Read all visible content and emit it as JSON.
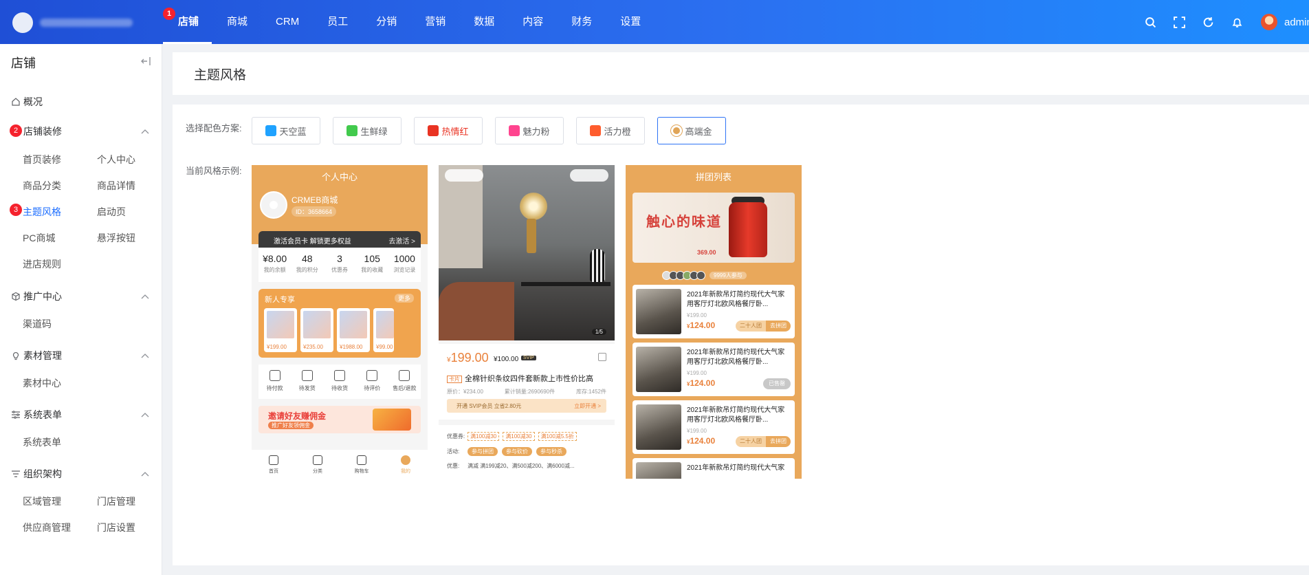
{
  "header": {
    "nav": [
      "店铺",
      "商城",
      "CRM",
      "员工",
      "分销",
      "营销",
      "数据",
      "内容",
      "财务",
      "设置"
    ],
    "active_index": 0,
    "nav_badge": "1",
    "user": "admin"
  },
  "sidebar": {
    "title": "店铺",
    "groups": [
      {
        "label": "概况"
      },
      {
        "label": "店铺装修",
        "badge": "2",
        "items": [
          "首页装修",
          "个人中心",
          "商品分类",
          "商品详情",
          "主题风格",
          "启动页",
          "PC商城",
          "悬浮按钮",
          "进店规则"
        ]
      },
      {
        "label": "推广中心",
        "items": [
          "渠道码"
        ]
      },
      {
        "label": "素材管理",
        "items": [
          "素材中心"
        ]
      },
      {
        "label": "系统表单",
        "items": [
          "系统表单"
        ]
      },
      {
        "label": "组织架构",
        "items": [
          "区域管理",
          "门店管理",
          "供应商管理",
          "门店设置"
        ]
      }
    ],
    "active_item": "主题风格",
    "active_badge": "3"
  },
  "page": {
    "title": "主题风格",
    "scheme_label": "选择配色方案:",
    "example_label": "当前风格示例:",
    "schemes": [
      {
        "name": "天空蓝",
        "color": "#1fa2ff"
      },
      {
        "name": "生鲜绿",
        "color": "#42ca4d"
      },
      {
        "name": "热情红",
        "color": "#e93323"
      },
      {
        "name": "魅力粉",
        "color": "#ff448f"
      },
      {
        "name": "活力橙",
        "color": "#fe5c2d"
      },
      {
        "name": "高端金",
        "color": "#e0a558"
      }
    ],
    "selected_scheme": "高端金",
    "hot_scheme_text_color": "#e93323"
  },
  "phone1": {
    "title": "个人中心",
    "user_name": "CRMEB商城",
    "user_id": "ID：3658664",
    "vip_text": "激活会员卡 解锁更多权益",
    "vip_action": "去激活 >",
    "stats": [
      {
        "value": "¥8.00",
        "label": "我的余额"
      },
      {
        "value": "48",
        "label": "我的积分"
      },
      {
        "value": "3",
        "label": "优惠券"
      },
      {
        "value": "105",
        "label": "我的收藏"
      },
      {
        "value": "1000",
        "label": "浏览记录"
      }
    ],
    "new_title": "新人专享",
    "new_more": "更多",
    "new_prices": [
      "¥199.00",
      "¥235.00",
      "¥1988.00",
      "¥99.00"
    ],
    "orders": [
      "待付款",
      "待发货",
      "待收货",
      "待评价",
      "售后/退款"
    ],
    "invite_title": "邀请好友赚佣金",
    "invite_sub": "推广好友领佣金",
    "tabs": [
      "首页",
      "分类",
      "购物车",
      "我的"
    ]
  },
  "phone2": {
    "pager": "1/5",
    "price": "199.00",
    "old_price": "¥100.00",
    "svip": "SVIP",
    "tag": "卡片",
    "name": "全棉针织条纹四件套新款上市性价比高",
    "meta": [
      "原价：¥234.00",
      "累计销量:2690690件",
      "库存:1452件"
    ],
    "svip_text": "开通 SVIP会员 立省2.80元",
    "svip_action": "立即开通 >",
    "coupon_label": "优惠券:",
    "coupons": [
      "满100减30",
      "满100减30",
      "满100减5.5折"
    ],
    "act_label": "活动:",
    "acts": [
      "参与拼团",
      "参与砍价",
      "参与秒杀"
    ],
    "promo_label": "优惠:",
    "promo_text": "满减 满199减20、满500减200、满6000减..."
  },
  "phone3": {
    "title": "拼团列表",
    "banner_text": "触心的味道",
    "banner_price": "369.00",
    "joined": "9999人参与",
    "items": [
      {
        "name": "2021年新款吊灯简约现代大气家用客厅灯北欧风格餐厅卧...",
        "old": "¥199.00",
        "price": "124.00",
        "tag": "二十人团",
        "btn": "去拼团"
      },
      {
        "name": "2021年新款吊灯简约现代大气家用客厅灯北欧风格餐厅卧...",
        "old": "¥199.00",
        "price": "124.00",
        "btn": "已售罄"
      },
      {
        "name": "2021年新款吊灯简约现代大气家用客厅灯北欧风格餐厅卧...",
        "old": "¥199.00",
        "price": "124.00",
        "tag": "二十人团",
        "btn": "去拼团"
      },
      {
        "name": "2021年新款吊灯简约现代大气家",
        "old": "",
        "price": ""
      }
    ]
  }
}
